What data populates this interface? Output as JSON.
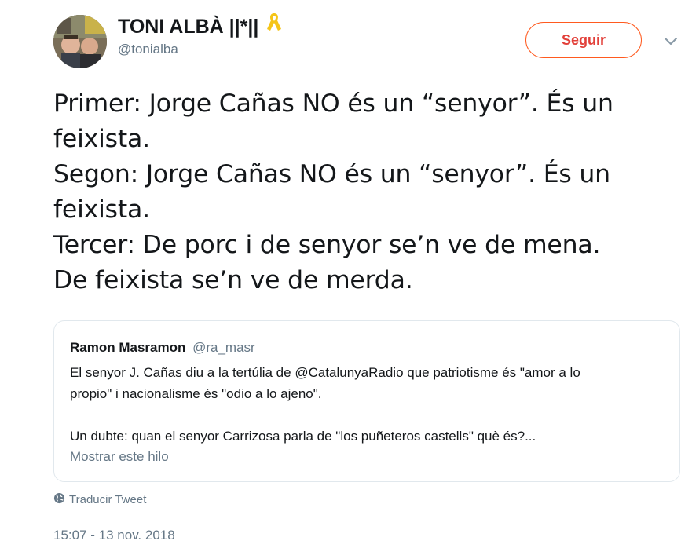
{
  "author": {
    "display_name": "TONI ALBÀ ||*||",
    "username": "@tonialba",
    "badge_icon": "yellow-ribbon-icon",
    "badge_color": "#f5c518"
  },
  "follow_button": {
    "label": "Seguir",
    "color": "#e2403a"
  },
  "more_menu_icon": "chevron-down-icon",
  "tweet": {
    "lines": [
      "Primer: Jorge Cañas NO és un “senyor”. És un",
      "feixista.",
      "Segon: Jorge Cañas NO és un “senyor”. És un",
      "feixista.",
      "Tercer: De porc i de senyor se’n ve de mena.",
      "De feixista se’n ve de merda."
    ]
  },
  "quoted_tweet": {
    "name": "Ramon Masramon",
    "handle": "@ra_masr",
    "lines": [
      "El senyor J. Cañas diu a la tertúlia de @CatalunyaRadio que patriotisme és \"amor a lo",
      "propio\" i nacionalisme és \"odio a lo ajeno\".",
      "Un dubte: quan el senyor Carrizosa parla de \"los puñeteros castells\" què és?..."
    ],
    "show_thread": "Mostrar este hilo"
  },
  "translate": {
    "label": "Traducir Tweet",
    "icon": "globe-icon"
  },
  "timestamp": "15:07 - 13 nov. 2018"
}
